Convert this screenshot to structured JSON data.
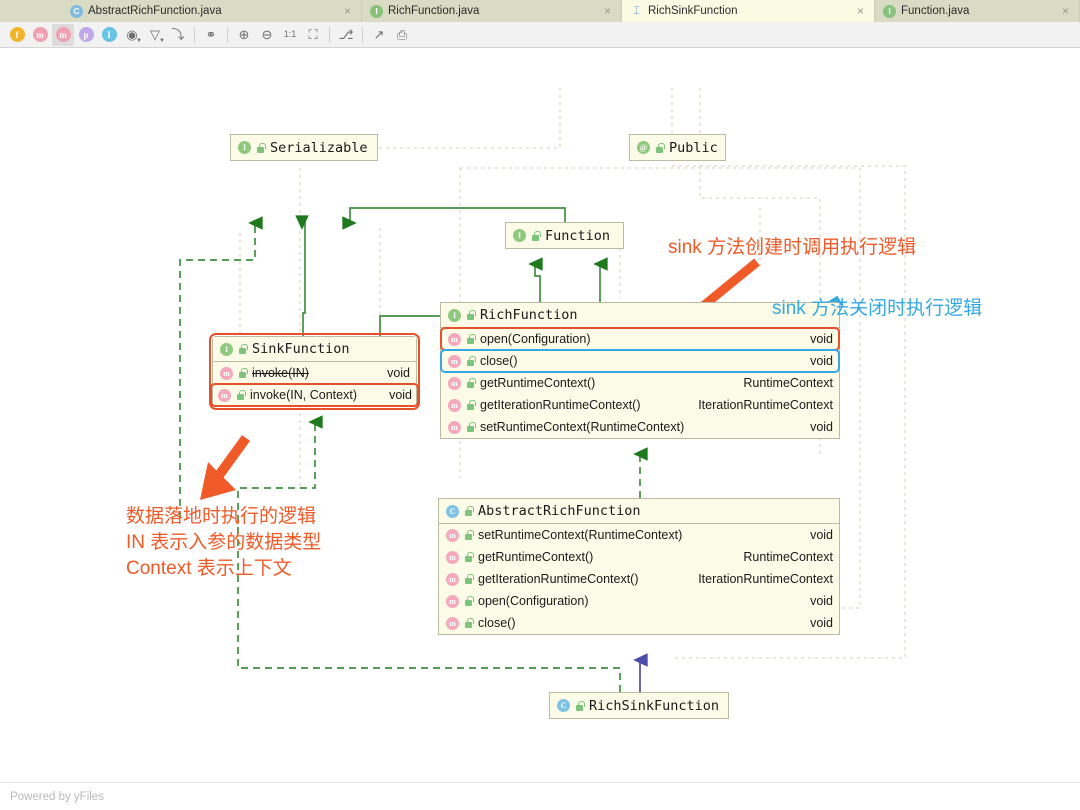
{
  "window": {
    "footer_text": "Powered by yFiles"
  },
  "tabs": [
    {
      "label": "AbstractRichFunction.java",
      "icon": "class-icon",
      "icon_kind": "cls",
      "icon_char": "C",
      "active": false,
      "close": "×"
    },
    {
      "label": "RichFunction.java",
      "icon": "interface-icon",
      "icon_kind": "iface",
      "icon_char": "I",
      "active": false,
      "close": "×"
    },
    {
      "label": "RichSinkFunction",
      "icon": "diagram-icon",
      "icon_kind": "diagram",
      "icon_char": "⌶",
      "active": true,
      "close": "×"
    },
    {
      "label": "Function.java",
      "icon": "interface-icon",
      "icon_kind": "iface",
      "icon_char": "I",
      "active": false,
      "close": "×"
    }
  ],
  "toolbar": {
    "items": [
      {
        "name": "show-fields-button",
        "kind": "badge",
        "style": "f",
        "glyph": "f",
        "selected": false
      },
      {
        "name": "show-constructors-button",
        "kind": "badge",
        "style": "ms",
        "glyph": "m",
        "selected": false
      },
      {
        "name": "show-methods-button",
        "kind": "badge",
        "style": "m",
        "glyph": "m",
        "selected": true
      },
      {
        "name": "show-properties-button",
        "kind": "badge",
        "style": "p",
        "glyph": "p",
        "selected": false
      },
      {
        "name": "show-inner-classes-button",
        "kind": "badge",
        "style": "i",
        "glyph": "I",
        "selected": false
      },
      {
        "name": "visibility-scope-button",
        "kind": "glyph",
        "glyph": "◉",
        "dropdown": true,
        "selected": false
      },
      {
        "name": "filter-button",
        "kind": "glyph",
        "glyph": "▽",
        "dropdown": true,
        "selected": false
      },
      {
        "name": "edge-mode-button",
        "kind": "glyph",
        "glyph": "⤵",
        "selected": false
      },
      {
        "name": "separator-1",
        "kind": "sep"
      },
      {
        "name": "show-dependencies-button",
        "kind": "glyph",
        "glyph": "⚭",
        "selected": false
      },
      {
        "name": "separator-2",
        "kind": "sep"
      },
      {
        "name": "zoom-in-button",
        "kind": "glyph",
        "glyph": "⊕",
        "selected": false
      },
      {
        "name": "zoom-out-button",
        "kind": "glyph",
        "glyph": "⊖",
        "selected": false
      },
      {
        "name": "actual-size-button",
        "kind": "glyph",
        "glyph": "1:1",
        "small": true,
        "selected": false
      },
      {
        "name": "fit-content-button",
        "kind": "glyph",
        "glyph": "⛶",
        "selected": false
      },
      {
        "name": "separator-3",
        "kind": "sep"
      },
      {
        "name": "layout-button",
        "kind": "glyph",
        "glyph": "⎇",
        "selected": false
      },
      {
        "name": "separator-4",
        "kind": "sep"
      },
      {
        "name": "export-button",
        "kind": "glyph",
        "glyph": "↗",
        "selected": false
      },
      {
        "name": "print-button",
        "kind": "glyph",
        "glyph": "⎙",
        "selected": false
      }
    ]
  },
  "diagram": {
    "nodes": [
      {
        "id": "serializable",
        "title": "Serializable",
        "stereotype": "interface",
        "icon_char": "I",
        "members": []
      },
      {
        "id": "public",
        "title": "Public",
        "stereotype": "annotation",
        "icon_char": "@",
        "members": []
      },
      {
        "id": "function",
        "title": "Function",
        "stereotype": "interface",
        "icon_char": "I",
        "members": []
      },
      {
        "id": "sinkfunction",
        "title": "SinkFunction",
        "stereotype": "interface",
        "icon_char": "I",
        "highlight": "red-box",
        "members": [
          {
            "name": "invoke(IN)",
            "type": "void",
            "deprecated": true,
            "highlight": "none"
          },
          {
            "name": "invoke(IN, Context)",
            "type": "void",
            "deprecated": false,
            "highlight": "red"
          }
        ]
      },
      {
        "id": "richfunction",
        "title": "RichFunction",
        "stereotype": "interface",
        "icon_char": "I",
        "members": [
          {
            "name": "open(Configuration)",
            "type": "void",
            "deprecated": false,
            "highlight": "red"
          },
          {
            "name": "close()",
            "type": "void",
            "deprecated": false,
            "highlight": "blue"
          },
          {
            "name": "getRuntimeContext()",
            "type": "RuntimeContext",
            "deprecated": false,
            "highlight": "none"
          },
          {
            "name": "getIterationRuntimeContext()",
            "type": "IterationRuntimeContext",
            "deprecated": false,
            "highlight": "none"
          },
          {
            "name": "setRuntimeContext(RuntimeContext)",
            "type": "void",
            "deprecated": false,
            "highlight": "none"
          }
        ]
      },
      {
        "id": "abstractrichfunction",
        "title": "AbstractRichFunction",
        "stereotype": "class",
        "icon_char": "C",
        "members": [
          {
            "name": "setRuntimeContext(RuntimeContext)",
            "type": "void",
            "deprecated": false,
            "highlight": "none"
          },
          {
            "name": "getRuntimeContext()",
            "type": "RuntimeContext",
            "deprecated": false,
            "highlight": "none"
          },
          {
            "name": "getIterationRuntimeContext()",
            "type": "IterationRuntimeContext",
            "deprecated": false,
            "highlight": "none"
          },
          {
            "name": "open(Configuration)",
            "type": "void",
            "deprecated": false,
            "highlight": "none"
          },
          {
            "name": "close()",
            "type": "void",
            "deprecated": false,
            "highlight": "none"
          }
        ]
      },
      {
        "id": "richsinkfunction",
        "title": "RichSinkFunction",
        "stereotype": "class",
        "icon_char": "C",
        "members": []
      }
    ],
    "annotations": [
      {
        "id": "open",
        "text": "sink 方法创建时调用执行逻辑",
        "color": "#f05a28",
        "arrow": "orange"
      },
      {
        "id": "close",
        "text": "sink 方法关闭时执行逻辑",
        "color": "#35a8e0",
        "arrow": "blue"
      },
      {
        "id": "invoke",
        "text": "数据落地时执行的逻辑\nIN 表示入参的数据类型\nContext 表示上下文",
        "color": "#f05a28",
        "arrow": "orange"
      }
    ],
    "colors": {
      "inheritance_edge": "#3f8f3f",
      "realization_edge": "#3f8f3f",
      "extends_edge": "#4b4ba8",
      "dependency_edge": "#d8d2bb",
      "node_fill": "#fbfbe8",
      "node_border": "#b9bba2",
      "highlight_red": "#e8502a",
      "highlight_blue": "#35a8e0"
    }
  }
}
